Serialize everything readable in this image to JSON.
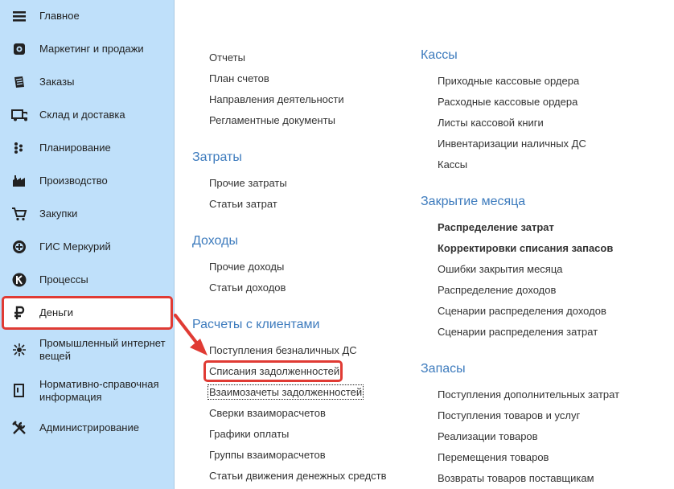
{
  "sidebar": {
    "items": [
      {
        "label": "Главное",
        "icon": "menu-icon"
      },
      {
        "label": "Маркетинг и продажи",
        "icon": "marketing-icon"
      },
      {
        "label": "Заказы",
        "icon": "orders-icon"
      },
      {
        "label": "Склад и доставка",
        "icon": "truck-icon"
      },
      {
        "label": "Планирование",
        "icon": "planning-icon"
      },
      {
        "label": "Производство",
        "icon": "factory-icon"
      },
      {
        "label": "Закупки",
        "icon": "cart-icon"
      },
      {
        "label": "ГИС Меркурий",
        "icon": "mercury-icon"
      },
      {
        "label": "Процессы",
        "icon": "processes-icon"
      },
      {
        "label": "Деньги",
        "icon": "ruble-icon"
      },
      {
        "label": "Промышленный интернет вещей",
        "icon": "iot-icon"
      },
      {
        "label": "Нормативно-справочная информация",
        "icon": "reference-icon"
      },
      {
        "label": "Администрирование",
        "icon": "admin-icon"
      }
    ]
  },
  "left_column": {
    "top_links": [
      "Отчеты",
      "План счетов",
      "Направления деятельности",
      "Регламентные документы"
    ],
    "costs": {
      "title": "Затраты",
      "links": [
        "Прочие затраты",
        "Статьи затрат"
      ]
    },
    "income": {
      "title": "Доходы",
      "links": [
        "Прочие доходы",
        "Статьи доходов"
      ]
    },
    "clients": {
      "title": "Расчеты с клиентами",
      "links": [
        "Поступления безналичных ДС",
        "Списания задолженностей",
        "Взаимозачеты задолженностей",
        "Сверки взаиморасчетов",
        "Графики оплаты",
        "Группы взаиморасчетов",
        "Статьи движения денежных средств"
      ]
    }
  },
  "right_column": {
    "cash": {
      "title": "Кассы",
      "links": [
        "Приходные кассовые ордера",
        "Расходные кассовые ордера",
        "Листы кассовой книги",
        "Инвентаризации наличных ДС",
        "Кассы"
      ]
    },
    "month_close": {
      "title": "Закрытие месяца",
      "links": [
        "Распределение затрат",
        "Корректировки списания запасов",
        "Ошибки закрытия месяца",
        "Распределение доходов",
        "Сценарии распределения доходов",
        "Сценарии распределения затрат"
      ]
    },
    "stock": {
      "title": "Запасы",
      "links": [
        "Поступления дополнительных затрат",
        "Поступления товаров и услуг",
        "Реализации товаров",
        "Перемещения товаров",
        "Возвраты товаров поставщикам"
      ]
    }
  },
  "colors": {
    "accent": "#e03b34",
    "group_title": "#3d7bbd",
    "sidebar_bg": "#bfe0fa"
  }
}
